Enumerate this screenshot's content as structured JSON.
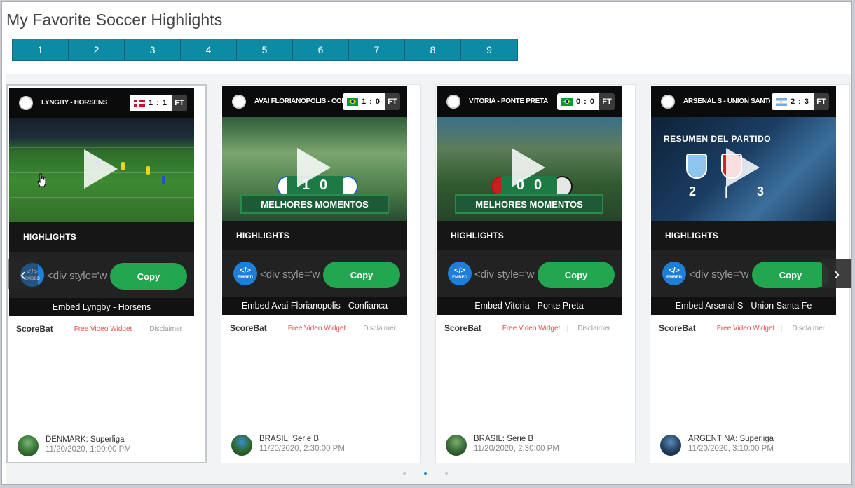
{
  "page": {
    "title": "My Favorite Soccer Highlights"
  },
  "pagination": {
    "pages": [
      "1",
      "2",
      "3",
      "4",
      "5",
      "6",
      "7",
      "8",
      "9"
    ]
  },
  "cards": [
    {
      "match": "LYNGBY - HORSENS",
      "flag": "denmark-flag",
      "score": "1 : 1",
      "status": "FT",
      "highlights": "HIGHLIGHTS",
      "embed_value": "<div style='w",
      "copy": "Copy",
      "embed_caption": "Embed Lyngby - Horsens",
      "brand": "ScoreBat",
      "widget_link": "Free Video Widget",
      "disclaimer": "Disclaimer",
      "league": "DENMARK: Superliga",
      "time": "11/20/2020, 1:00:00 PM"
    },
    {
      "match": "AVAI FLORIANOPOLIS - CONFIANCA",
      "flag": "brazil-flag",
      "score": "1 : 0",
      "status": "FT",
      "thumb_score": [
        "1",
        "0"
      ],
      "thumb_banner": "MELHORES MOMENTOS",
      "highlights": "HIGHLIGHTS",
      "embed_value": "<div style='w",
      "copy": "Copy",
      "embed_caption": "Embed Avai Florianopolis - Confianca",
      "brand": "ScoreBat",
      "widget_link": "Free Video Widget",
      "disclaimer": "Disclaimer",
      "league": "BRASIL: Serie B",
      "time": "11/20/2020, 2:30:00 PM"
    },
    {
      "match": "VITORIA - PONTE PRETA",
      "flag": "brazil-flag",
      "score": "0 : 0",
      "status": "FT",
      "thumb_score": [
        "0",
        "0"
      ],
      "thumb_banner": "MELHORES MOMENTOS",
      "highlights": "HIGHLIGHTS",
      "embed_value": "<div style='w",
      "copy": "Copy",
      "embed_caption": "Embed Vitoria - Ponte Preta",
      "brand": "ScoreBat",
      "widget_link": "Free Video Widget",
      "disclaimer": "Disclaimer",
      "league": "BRASIL: Serie B",
      "time": "11/20/2020, 2:30:00 PM"
    },
    {
      "match": "ARSENAL S - UNION SANTA FE",
      "flag": "argentina-flag",
      "score": "2 : 3",
      "status": "FT",
      "thumb_title": "RESUMEN DEL PARTIDO",
      "thumb_score": "2 | 3",
      "highlights": "HIGHLIGHTS",
      "embed_value": "<div style='w",
      "copy": "Copy",
      "embed_caption": "Embed Arsenal S - Union Santa Fe",
      "brand": "ScoreBat",
      "widget_link": "Free Video Widget",
      "disclaimer": "Disclaimer",
      "league": "ARGENTINA: Superliga",
      "time": "11/20/2020, 3:10:00 PM"
    }
  ],
  "embed_icon_label": "EMBED",
  "icons": {
    "prev": "chevron-left-icon",
    "next": "chevron-right-icon",
    "play": "play-icon",
    "embed": "embed-code-icon"
  },
  "carousel": {
    "dots": 3,
    "active_dot": 2
  },
  "colors": {
    "accent": "#0d8aa4",
    "copy_green": "#22a64f",
    "link_red": "#d9534f"
  }
}
